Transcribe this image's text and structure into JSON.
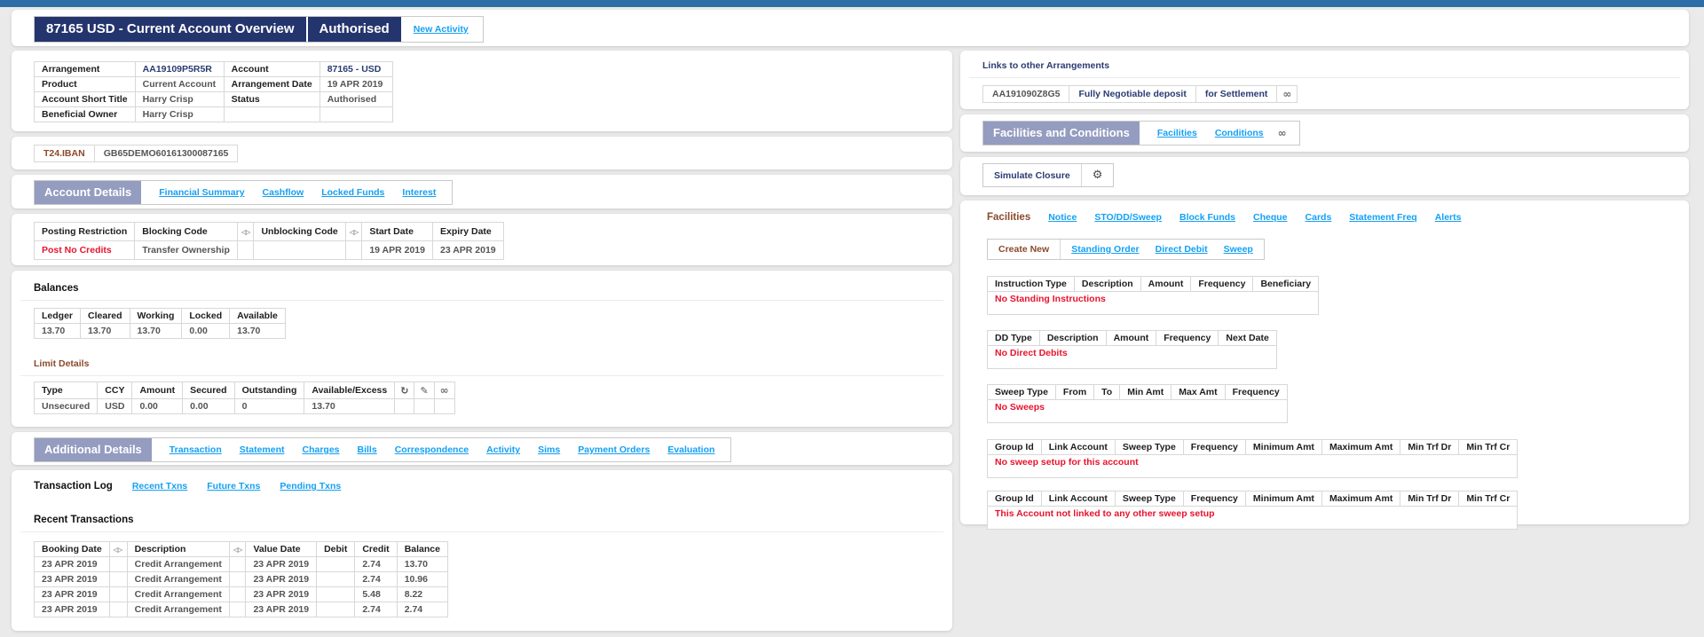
{
  "title_bar": {
    "title": "87165 USD - Current Account Overview",
    "status": "Authorised",
    "new_activity": "New Activity"
  },
  "arrangement": {
    "rows": [
      {
        "label": "Arrangement",
        "value": "AA19109P5R5R",
        "label2": "Account",
        "value2": "87165 - USD"
      },
      {
        "label": "Product",
        "value": "Current Account",
        "label2": "Arrangement Date",
        "value2": "19 APR 2019"
      },
      {
        "label": "Account Short Title",
        "value": "Harry Crisp",
        "label2": "Status",
        "value2": "Authorised"
      },
      {
        "label": "Beneficial Owner",
        "value": "Harry Crisp",
        "label2": "",
        "value2": ""
      }
    ]
  },
  "iban": {
    "label": "T24.IBAN",
    "value": "GB65DEMO60161300087165"
  },
  "account_details": {
    "header": "Account Details",
    "tabs": [
      "Financial Summary",
      "Cashflow",
      "Locked Funds",
      "Interest"
    ]
  },
  "posting": {
    "headers": [
      "Posting Restriction",
      "Blocking Code",
      "Unblocking Code",
      "Start Date",
      "Expiry Date"
    ],
    "row": {
      "restriction": "Post No Credits",
      "blocking": "Transfer Ownership",
      "unblocking": "",
      "start": "19 APR 2019",
      "expiry": "23 APR 2019"
    }
  },
  "balances": {
    "title": "Balances",
    "headers": [
      "Ledger",
      "Cleared",
      "Working",
      "Locked",
      "Available"
    ],
    "values": [
      "13.70",
      "13.70",
      "13.70",
      "0.00",
      "13.70"
    ]
  },
  "limit": {
    "title": "Limit Details",
    "headers": [
      "Type",
      "CCY",
      "Amount",
      "Secured",
      "Outstanding",
      "Available/Excess"
    ],
    "row": [
      "Unsecured",
      "USD",
      "0.00",
      "0.00",
      "0",
      "13.70"
    ]
  },
  "additional_details": {
    "header": "Additional Details",
    "tabs": [
      "Transaction",
      "Statement",
      "Charges",
      "Bills",
      "Correspondence",
      "Activity",
      "Sims",
      "Payment Orders",
      "Evaluation"
    ]
  },
  "transaction_log": {
    "title": "Transaction Log",
    "tabs": [
      "Recent Txns",
      "Future Txns",
      "Pending Txns"
    ],
    "subtitle": "Recent Transactions",
    "headers": [
      "Booking Date",
      "Description",
      "Value Date",
      "Debit",
      "Credit",
      "Balance"
    ],
    "rows": [
      [
        "23 APR 2019",
        "Credit Arrangement",
        "23 APR 2019",
        "",
        "2.74",
        "13.70"
      ],
      [
        "23 APR 2019",
        "Credit Arrangement",
        "23 APR 2019",
        "",
        "2.74",
        "10.96"
      ],
      [
        "23 APR 2019",
        "Credit Arrangement",
        "23 APR 2019",
        "",
        "5.48",
        "8.22"
      ],
      [
        "23 APR 2019",
        "Credit Arrangement",
        "23 APR 2019",
        "",
        "2.74",
        "2.74"
      ]
    ]
  },
  "links_arrangements": {
    "title": "Links to other Arrangements",
    "row": [
      "AA191090Z8G5",
      "Fully Negotiable deposit",
      "for Settlement"
    ]
  },
  "facilities_conditions": {
    "header": "Facilities and Conditions",
    "tabs": [
      "Facilities",
      "Conditions"
    ]
  },
  "simulate": {
    "label": "Simulate Closure"
  },
  "facilities": {
    "title": "Facilities",
    "tabs": [
      "Notice",
      "STO/DD/Sweep",
      "Block Funds",
      "Cheque",
      "Cards",
      "Statement Freq",
      "Alerts"
    ],
    "create_new": {
      "label": "Create New",
      "tabs": [
        "Standing Order",
        "Direct Debit",
        "Sweep"
      ]
    },
    "standing": {
      "headers": [
        "Instruction Type",
        "Description",
        "Amount",
        "Frequency",
        "Beneficiary"
      ],
      "empty": "No Standing Instructions"
    },
    "direct_debits": {
      "headers": [
        "DD Type",
        "Description",
        "Amount",
        "Frequency",
        "Next Date"
      ],
      "empty": "No Direct Debits"
    },
    "sweeps": {
      "headers": [
        "Sweep Type",
        "From",
        "To",
        "Min Amt",
        "Max Amt",
        "Frequency"
      ],
      "empty": "No Sweeps"
    },
    "sweep_setup": {
      "headers": [
        "Group Id",
        "Link Account",
        "Sweep Type",
        "Frequency",
        "Minimum Amt",
        "Maximum Amt",
        "Min Trf Dr",
        "Min Trf Cr"
      ],
      "empty": "No sweep setup for this account"
    },
    "sweep_linked": {
      "headers": [
        "Group Id",
        "Link Account",
        "Sweep Type",
        "Frequency",
        "Minimum Amt",
        "Maximum Amt",
        "Min Trf Dr",
        "Min Trf Cr"
      ],
      "empty": "This Account not linked to any other sweep setup"
    }
  },
  "colors": {
    "topbar": "#2d6ea6",
    "navy_header": "#24356e",
    "section_header_bg": "#949cc0",
    "link_blue": "#14a0f3",
    "alert_red": "#e8132d",
    "label_brown": "#8a4a2b"
  }
}
